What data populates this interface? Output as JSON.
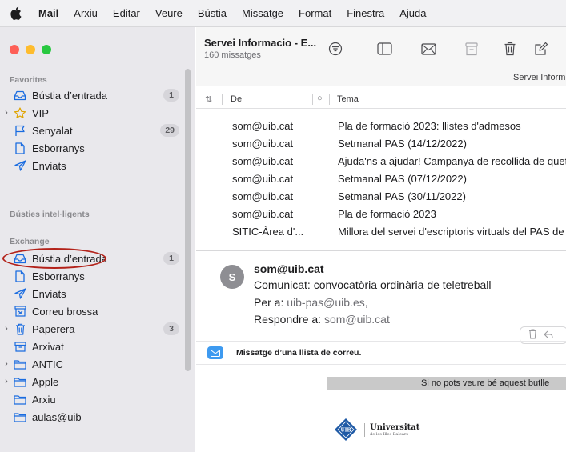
{
  "menubar": {
    "app": "Mail",
    "items": [
      "Arxiu",
      "Editar",
      "Veure",
      "Bústia",
      "Missatge",
      "Format",
      "Finestra",
      "Ajuda"
    ]
  },
  "sidebar": {
    "favorites_label": "Favorites",
    "smart_label": "Bústies intel·ligents",
    "exchange_label": "Exchange",
    "favorites": [
      {
        "label": "Bústia d’entrada",
        "badge": "1",
        "icon": "inbox-icon"
      },
      {
        "label": "VIP",
        "badge": "",
        "icon": "star-icon"
      },
      {
        "label": "Senyalat",
        "badge": "29",
        "icon": "flag-icon"
      },
      {
        "label": "Esborranys",
        "badge": "",
        "icon": "document-icon"
      },
      {
        "label": "Enviats",
        "badge": "",
        "icon": "paperplane-icon"
      }
    ],
    "exchange": [
      {
        "label": "Bústia d’entrada",
        "badge": "1",
        "icon": "inbox-icon"
      },
      {
        "label": "Esborranys",
        "badge": "",
        "icon": "document-icon"
      },
      {
        "label": "Enviats",
        "badge": "",
        "icon": "paperplane-icon"
      },
      {
        "label": "Correu brossa",
        "badge": "",
        "icon": "junk-icon"
      },
      {
        "label": "Paperera",
        "badge": "3",
        "icon": "trash-icon"
      },
      {
        "label": "Arxivat",
        "badge": "",
        "icon": "archive-icon"
      },
      {
        "label": "ANTIC",
        "badge": "",
        "icon": "folder-icon"
      },
      {
        "label": "Apple",
        "badge": "",
        "icon": "folder-icon"
      },
      {
        "label": "Arxiu",
        "badge": "",
        "icon": "folder-icon"
      },
      {
        "label": "aulas@uib",
        "badge": "",
        "icon": "folder-icon"
      }
    ]
  },
  "toolbar": {
    "mailbox_title": "Servei Informacio - E...",
    "message_count": "160 missatges",
    "filter_text": "Servei Inform"
  },
  "columns": {
    "from": "De",
    "subject": "Tema"
  },
  "messages": [
    {
      "from": "som@uib.cat",
      "subject": "Pla de formació 2023: llistes d'admesos"
    },
    {
      "from": "som@uib.cat",
      "subject": "Setmanal PAS (14/12/2022)"
    },
    {
      "from": "som@uib.cat",
      "subject": "Ajuda'ns a ajudar! Campanya de recollida de quet"
    },
    {
      "from": "som@uib.cat",
      "subject": "Setmanal PAS (07/12/2022)"
    },
    {
      "from": "som@uib.cat",
      "subject": "Setmanal PAS (30/11/2022)"
    },
    {
      "from": "som@uib.cat",
      "subject": "Pla de formació 2023"
    },
    {
      "from": "SITIC-Àrea d'...",
      "subject": "Millora del servei d'escriptoris virtuals del PAS de"
    }
  ],
  "preview": {
    "avatar": "S",
    "from": "som@uib.cat",
    "subject": "Comunicat: convocatòria ordinària de teletreball",
    "to_label": "Per a:",
    "to_value": "uib-pas@uib.es,",
    "reply_label": "Respondre a:",
    "reply_value": "som@uib.cat",
    "list_banner": "Missatge d’una llista de correu.",
    "gray_bar_text": "Si no pots veure bé aquest butlle",
    "logo_title": "Universitat",
    "logo_subtitle": "de les Illes Balears",
    "emblem_text": "UIB"
  },
  "colors": {
    "traffic_red": "#fe5f57",
    "traffic_yellow": "#febc2e",
    "traffic_green": "#28c840",
    "accent_blue": "#1a6ce0",
    "annotation_red": "#b3221a"
  }
}
